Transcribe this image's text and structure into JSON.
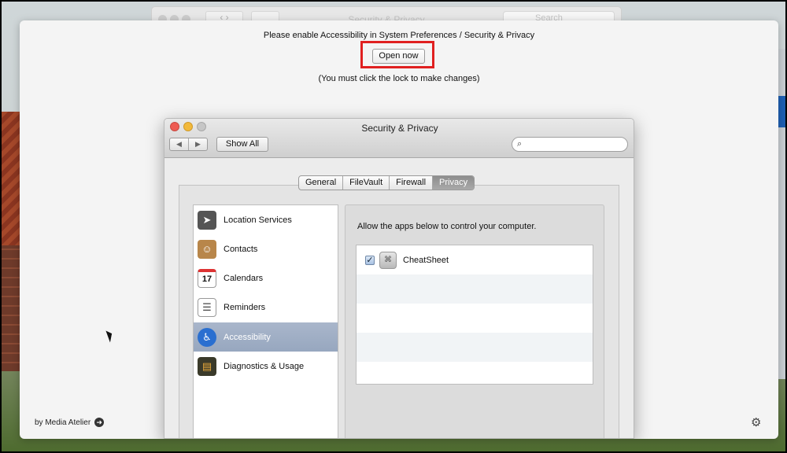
{
  "background_window": {
    "title": "Security & Privacy",
    "search_placeholder": "Search"
  },
  "overlay": {
    "message": "Please enable Accessibility in System Preferences  / Security & Privacy",
    "open_button": "Open now",
    "note": "(You must click the lock to make changes)",
    "brand": "by Media Atelier"
  },
  "window": {
    "title": "Security & Privacy",
    "show_all": "Show All",
    "tabs": [
      {
        "label": "General"
      },
      {
        "label": "FileVault"
      },
      {
        "label": "Firewall"
      },
      {
        "label": "Privacy"
      }
    ],
    "active_tab": "Privacy",
    "sidebar": [
      {
        "label": "Location Services",
        "icon": "location-icon"
      },
      {
        "label": "Contacts",
        "icon": "contacts-icon"
      },
      {
        "label": "Calendars",
        "icon": "calendar-icon",
        "icon_text": "17"
      },
      {
        "label": "Reminders",
        "icon": "reminders-icon"
      },
      {
        "label": "Accessibility",
        "icon": "accessibility-icon",
        "selected": true
      },
      {
        "label": "Diagnostics & Usage",
        "icon": "diagnostics-icon"
      }
    ],
    "right_label": "Allow the apps below to control your computer.",
    "apps": [
      {
        "name": "CheatSheet",
        "checked": true
      }
    ]
  },
  "colors": {
    "highlight": "#e02020",
    "selected_row": "#a9b6cb"
  }
}
